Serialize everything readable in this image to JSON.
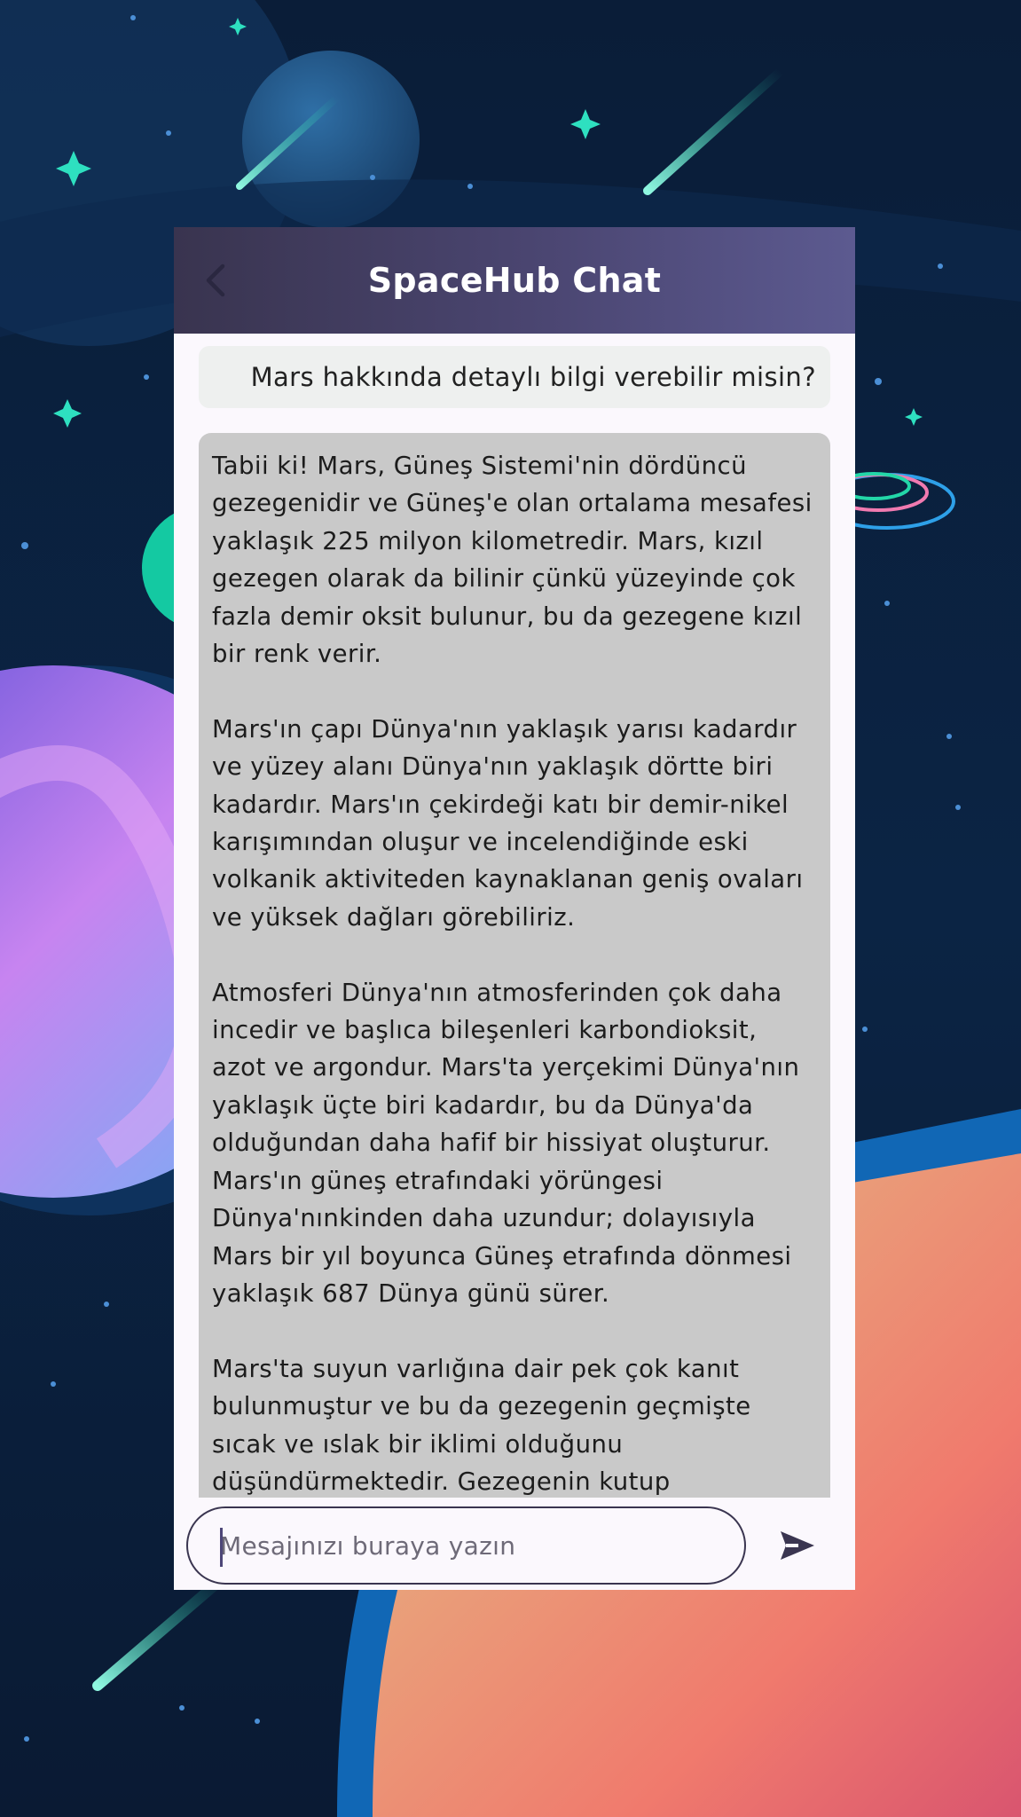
{
  "app": {
    "title": "SpaceHub Chat"
  },
  "header": {
    "back_icon": "chevron-left-icon"
  },
  "messages": {
    "user": "Mars hakkında detaylı bilgi verebilir misin?",
    "bot_paragraphs": [
      "Tabii ki! Mars, Güneş Sistemi'nin dördüncü gezegenidir ve Güneş'e olan ortalama mesafesi yaklaşık 225 milyon kilometredir. Mars, kızıl gezegen olarak da bilinir çünkü yüzeyinde çok fazla demir oksit bulunur, bu da gezegene kızıl bir renk verir.",
      "Mars'ın çapı Dünya'nın yaklaşık yarısı kadardır ve yüzey alanı Dünya'nın yaklaşık dörtte biri kadardır. Mars'ın çekirdeği katı bir demir-nikel karışımından oluşur ve incelendiğinde eski volkanik aktiviteden kaynaklanan geniş ovaları ve yüksek dağları görebiliriz.",
      "Atmosferi Dünya'nın atmosferinden çok daha incedir ve başlıca bileşenleri karbondioksit, azot ve argondur. Mars'ta yerçekimi Dünya'nın yaklaşık üçte biri kadardır, bu da Dünya'da olduğundan daha hafif bir hissiyat oluşturur. Mars'ın güneş etrafındaki yörüngesi Dünya'nınkinden daha uzundur; dolayısıyla Mars bir yıl boyunca Güneş etrafında dönmesi yaklaşık 687 Dünya günü sürer.",
      "Mars'ta suyun varlığına dair pek çok kanıt bulunmuştur ve bu da gezegenin geçmişte sıcak ve ıslak bir iklimi olduğunu düşündürmektedir. Gezegenin kutup"
    ]
  },
  "composer": {
    "placeholder": "Mesajınızı buraya yazın",
    "value": "",
    "send_icon": "send-icon"
  },
  "colors": {
    "header_start": "#39344f",
    "header_end": "#5c5a90",
    "bot_bubble": "#c9c9c9",
    "user_bubble": "#eef0ef",
    "window_bg": "#fbf8fd",
    "accent": "#3a3550"
  }
}
